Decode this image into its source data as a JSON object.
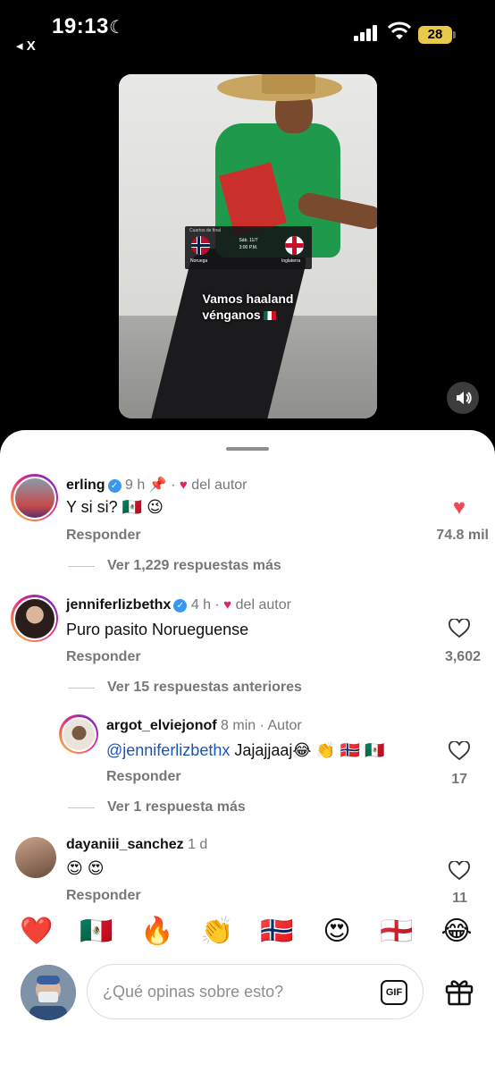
{
  "status_bar": {
    "time": "19:13",
    "back_label": "◂ X",
    "battery": "28"
  },
  "video": {
    "match_card": {
      "stage": "Cuartos de final",
      "date": "Sáb. 11/7",
      "time": "3:00 P.M.",
      "home": "Noruega",
      "away": "Inglaterra"
    },
    "caption_line1": "Vamos haaland",
    "caption_line2": "vénganos"
  },
  "comments": [
    {
      "username": "erling",
      "time": "9 h",
      "author_tag": "del autor",
      "text": "Y si si? 🇲🇽 😉",
      "reply_label": "Responder",
      "likes": "74.8 mil",
      "liked": true,
      "more_replies": "Ver 1,229 respuestas más"
    },
    {
      "username": "jenniferlizbethx",
      "time": "4 h",
      "author_tag": "del autor",
      "text": "Puro pasito Norueguense",
      "reply_label": "Responder",
      "likes": "3,602",
      "liked": false,
      "more_replies": "Ver 15 respuestas anteriores"
    },
    {
      "username": "argot_elviejonof",
      "time": "8 min",
      "author_tag": "Autor",
      "mention": "@jenniferlizbethx",
      "text": "Jajajjaaj😂 👏 🇳🇴 🇲🇽",
      "reply_label": "Responder",
      "likes": "17",
      "liked": false,
      "more_replies": "Ver 1 respuesta más"
    },
    {
      "username": "dayaniii_sanchez",
      "time": "1 d",
      "text": "😍 😍",
      "reply_label": "Responder",
      "likes": "11",
      "liked": false
    }
  ],
  "quick_reactions": [
    "❤️",
    "🇲🇽",
    "🔥",
    "👏",
    "🇳🇴",
    "😍",
    "🏴󠁧󠁢󠁥󠁮󠁧󠁿",
    "😂"
  ],
  "composer": {
    "placeholder": "¿Qué opinas sobre esto?",
    "gif_label": "GIF"
  },
  "colors": {
    "like_red": "#ed4956",
    "verified_blue": "#3897f0",
    "sheet_bg": "#ffffff"
  }
}
